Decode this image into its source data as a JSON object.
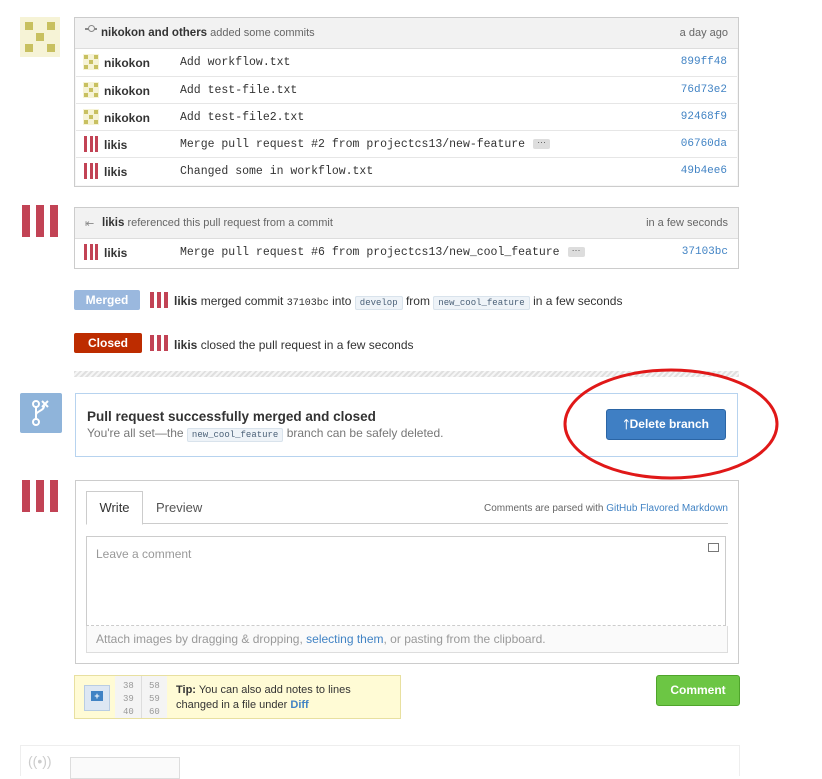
{
  "commits_group": {
    "header_user": "nikokon and others",
    "header_action": "added some commits",
    "header_time": "a day ago",
    "commits": [
      {
        "author": "nikokon",
        "message": "Add workflow.txt",
        "sha": "899ff48"
      },
      {
        "author": "nikokon",
        "message": "Add test-file.txt",
        "sha": "76d73e2"
      },
      {
        "author": "nikokon",
        "message": "Add test-file2.txt",
        "sha": "92468f9"
      },
      {
        "author": "likis",
        "message": "Merge pull request #2 from projectcs13/new-feature",
        "sha": "06760da",
        "ellipsis": "···"
      },
      {
        "author": "likis",
        "message": "Changed some in workflow.txt",
        "sha": "49b4ee6"
      }
    ]
  },
  "reference": {
    "user": "likis",
    "action": "referenced this pull request from a commit",
    "time": "in a few seconds",
    "commit": {
      "author": "likis",
      "message": "Merge pull request #6 from projectcs13/new_cool_feature",
      "sha": "37103bc",
      "ellipsis": "···"
    }
  },
  "merged_event": {
    "badge": "Merged",
    "user": "likis",
    "text1": "merged commit",
    "sha": "37103bc",
    "text2": "into",
    "base": "develop",
    "text3": "from",
    "head": "new_cool_feature",
    "time": "in a few seconds"
  },
  "closed_event": {
    "badge": "Closed",
    "user": "likis",
    "text": "closed the pull request in a few seconds"
  },
  "merge_status": {
    "title": "Pull request successfully merged and closed",
    "text_before": "You're all set—the",
    "branch": "new_cool_feature",
    "text_after": "branch can be safely deleted.",
    "button": "Delete branch"
  },
  "comment_form": {
    "tab_write": "Write",
    "tab_preview": "Preview",
    "parsed_note": "Comments are parsed with",
    "parsed_link": "GitHub Flavored Markdown",
    "placeholder": "Leave a comment",
    "attach_before": "Attach images by dragging & dropping,",
    "attach_link": "selecting them",
    "attach_after": ", or pasting from the clipboard."
  },
  "tip": {
    "label": "Tip:",
    "text": "You can also add notes to lines changed in a file under",
    "link": "Diff",
    "line_numbers_left": [
      "38",
      "39",
      "40"
    ],
    "line_numbers_right": [
      "58",
      "59",
      "60"
    ]
  },
  "comment_button": "Comment",
  "colors": {
    "merged": "#9ab8de",
    "closed": "#bd2c00",
    "link": "#4183c4",
    "green": "#6cc644"
  }
}
